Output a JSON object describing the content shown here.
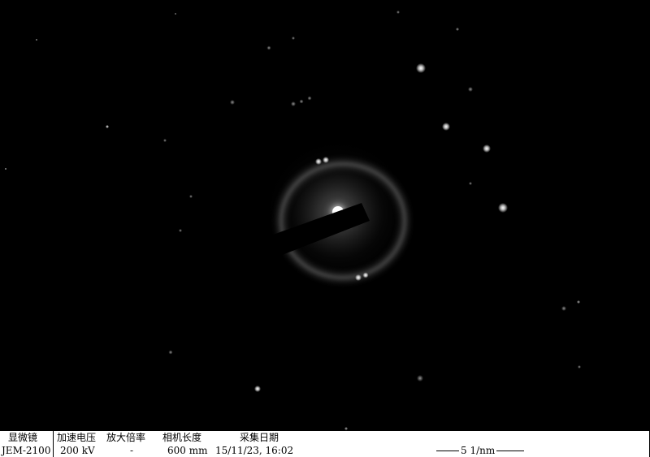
{
  "image": {
    "background_color": "#000000",
    "beam_stopper_color": "#000000",
    "ring_color": "#6f6f6f",
    "spot_color": "#ffffff"
  },
  "info_bar": {
    "microscope_label": "显微镜",
    "microscope_value": "JEM-2100",
    "voltage_label": "加速电压",
    "voltage_value": "200 kV",
    "magnification_label": "放大倍率",
    "magnification_value": "-",
    "camera_length_label": "相机长度",
    "camera_length_value": "600 mm",
    "date_label": "采集日期",
    "date_value": "15/11/23, 16:02",
    "scale_bar_label": "5 1/nm"
  }
}
